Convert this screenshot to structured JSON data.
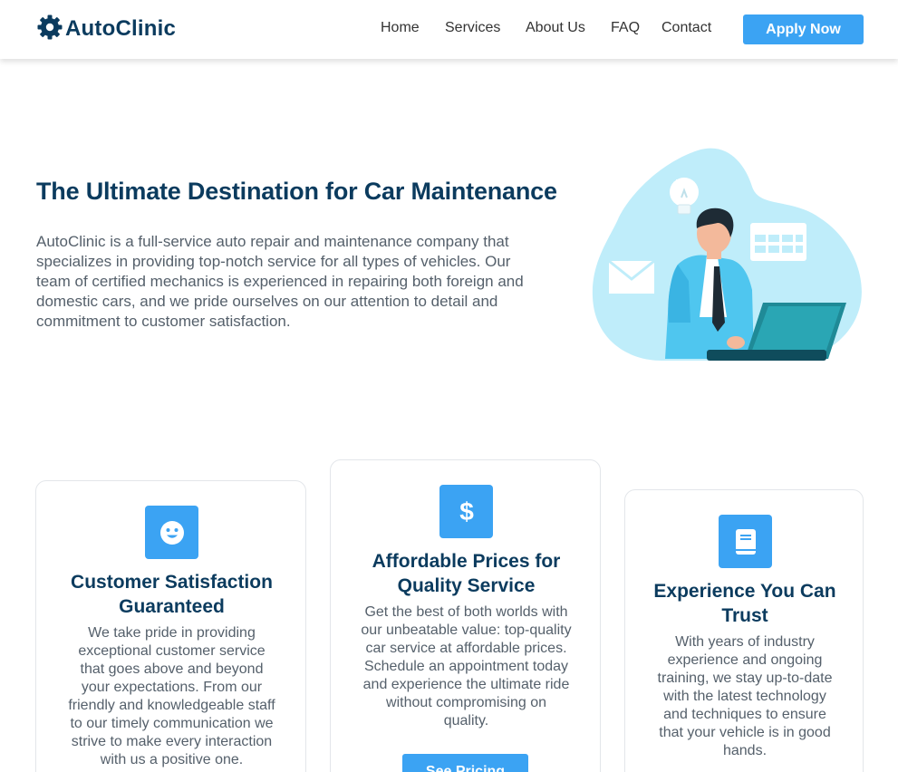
{
  "brand": {
    "name_part1": "Auto",
    "name_part2": "Clinic",
    "icon": "gear-icon",
    "color": "#0b3b5e"
  },
  "nav": {
    "items": [
      {
        "label": "Home"
      },
      {
        "label": "Services"
      },
      {
        "label": "About Us"
      },
      {
        "label": "FAQ"
      },
      {
        "label": "Contact"
      }
    ],
    "cta_label": "Apply Now"
  },
  "hero": {
    "title": "The Ultimate Destination for Car Maintenance",
    "text_lines": [
      "AutoClinic is a full-service auto repair and maintenance company that",
      "specializes in providing top-notch service for all types of vehicles. Our",
      "team of certified mechanics is experienced in repairing both foreign and",
      "domestic cars, and we pride ourselves on our attention to detail and",
      "commitment to customer satisfaction."
    ],
    "illustration": "businessman-at-laptop-illustration"
  },
  "features": [
    {
      "icon": "smiley-face-icon",
      "title_lines": [
        "Customer Satisfaction",
        "Guaranteed"
      ],
      "text_lines": [
        "We take pride in providing",
        "exceptional customer service",
        "that goes above and beyond",
        "your expectations. From our",
        "friendly and knowledgeable staff",
        "to our timely communication we",
        "strive to make every interaction",
        "with us a positive one."
      ]
    },
    {
      "icon": "dollar-sign-icon",
      "title_lines": [
        "Affordable Prices for",
        "Quality Service"
      ],
      "text_lines": [
        "Get the best of both worlds with",
        "our unbeatable value: top-quality",
        "car service at affordable prices.",
        "Schedule an appointment today",
        "and experience the ultimate ride",
        "without compromising on",
        "quality."
      ],
      "button_label": "See Pricing"
    },
    {
      "icon": "book-icon",
      "title_lines": [
        "Experience You Can",
        "Trust"
      ],
      "text_lines": [
        "With years of industry",
        "experience and ongoing",
        "training, we stay up-to-date",
        "with the latest technology",
        "and techniques to ensure",
        "that your vehicle is in good",
        "hands."
      ]
    }
  ],
  "colors": {
    "accent": "#3ba3f3",
    "heading": "#0b3b5e",
    "body_text": "#55606b",
    "blob": "#bfedfa"
  }
}
